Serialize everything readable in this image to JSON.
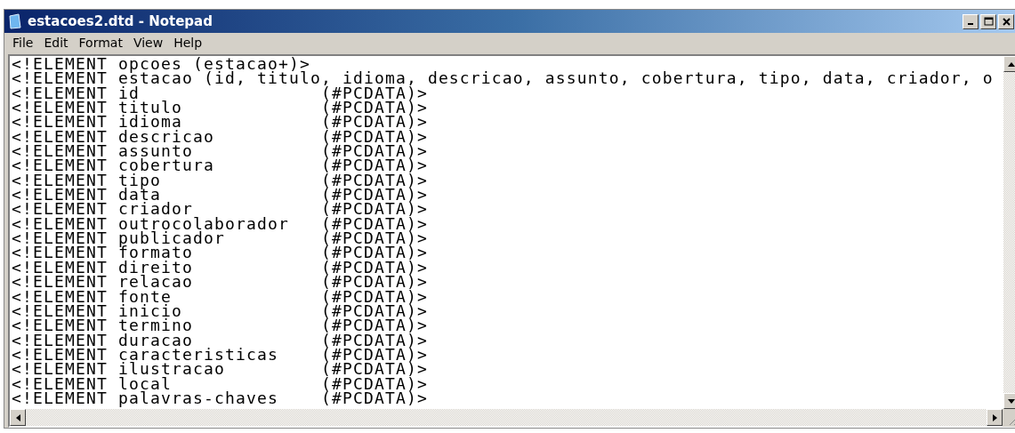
{
  "window": {
    "title": "estacoes2.dtd - Notepad"
  },
  "menu": [
    {
      "label": "File"
    },
    {
      "label": "Edit"
    },
    {
      "label": "Format"
    },
    {
      "label": "View"
    },
    {
      "label": "Help"
    }
  ],
  "editor": {
    "lines": [
      "<!ELEMENT opcoes (estacao+)>",
      "<!ELEMENT estacao (id, titulo, idioma, descricao, assunto, cobertura, tipo, data, criador, o",
      "<!ELEMENT id                 (#PCDATA)>",
      "<!ELEMENT titulo             (#PCDATA)>",
      "<!ELEMENT idioma             (#PCDATA)>",
      "<!ELEMENT descricao          (#PCDATA)>",
      "<!ELEMENT assunto            (#PCDATA)>",
      "<!ELEMENT cobertura          (#PCDATA)>",
      "<!ELEMENT tipo               (#PCDATA)>",
      "<!ELEMENT data               (#PCDATA)>",
      "<!ELEMENT criador            (#PCDATA)>",
      "<!ELEMENT outrocolaborador   (#PCDATA)>",
      "<!ELEMENT publicador         (#PCDATA)>",
      "<!ELEMENT formato            (#PCDATA)>",
      "<!ELEMENT direito            (#PCDATA)>",
      "<!ELEMENT relacao            (#PCDATA)>",
      "<!ELEMENT fonte              (#PCDATA)>",
      "<!ELEMENT inicio             (#PCDATA)>",
      "<!ELEMENT termino            (#PCDATA)>",
      "<!ELEMENT duracao            (#PCDATA)>",
      "<!ELEMENT caracteristicas    (#PCDATA)>",
      "<!ELEMENT ilustracao         (#PCDATA)>",
      "<!ELEMENT local              (#PCDATA)>",
      "<!ELEMENT palavras-chaves    (#PCDATA)>"
    ]
  }
}
